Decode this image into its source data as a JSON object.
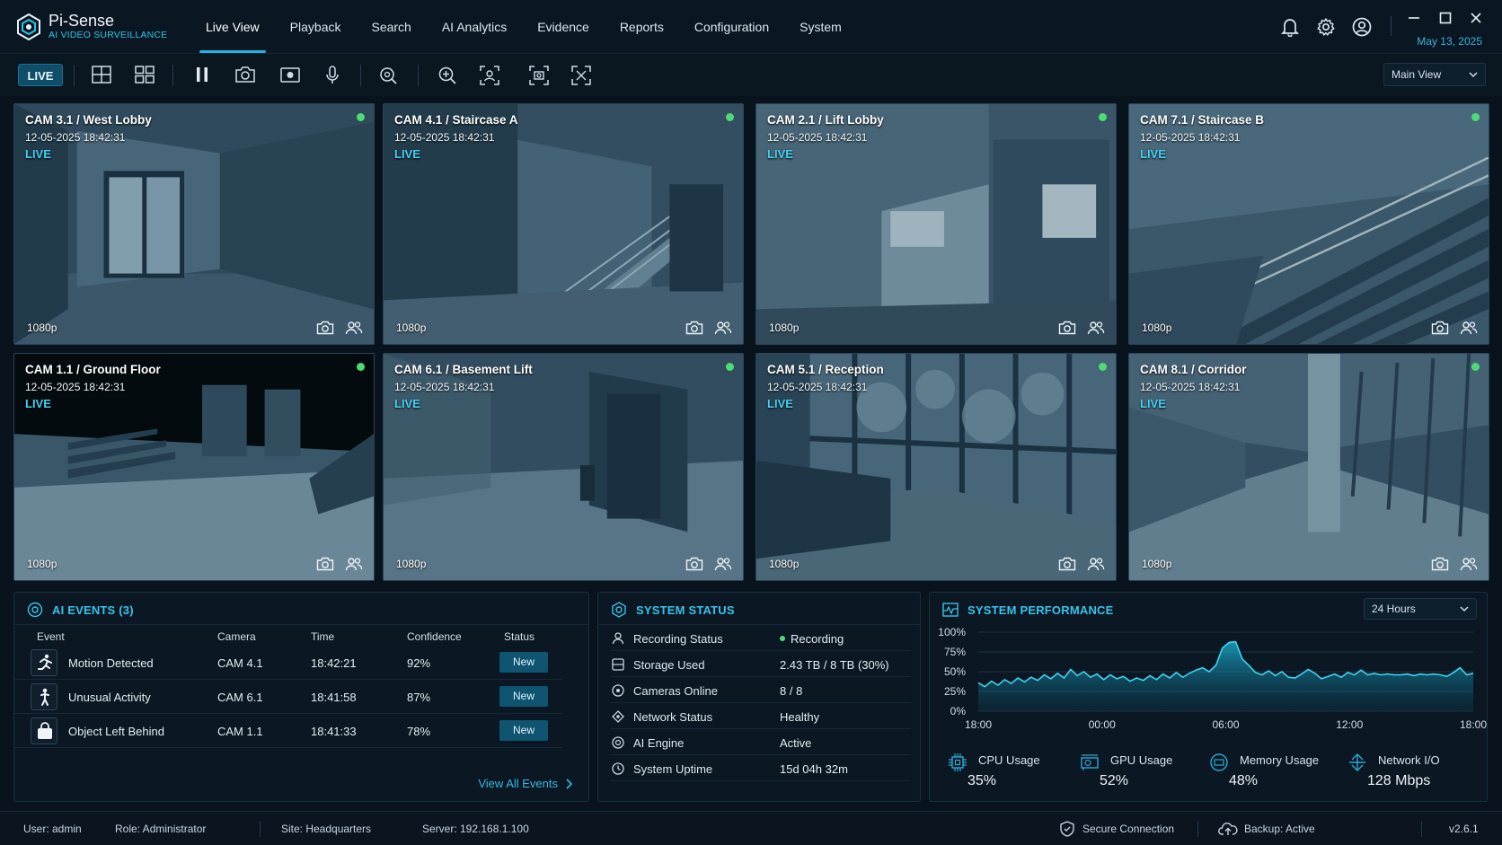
{
  "app": {
    "name": "Pi-Sense",
    "subtitle": "AI VIDEO SURVEILLANCE",
    "date": "May 13, 2025"
  },
  "nav": {
    "items": [
      "Live View",
      "Playback",
      "Search",
      "AI Analytics",
      "Evidence",
      "Reports",
      "Configuration",
      "System"
    ],
    "active_index": 0
  },
  "toolbar": {
    "live_label": "LIVE",
    "view_select": "Main View"
  },
  "cameras": [
    {
      "title": "CAM 3.1 / West Lobby",
      "timestamp": "12-05-2025 18:42:31",
      "status": "LIVE",
      "resolution": "1080p"
    },
    {
      "title": "CAM 4.1 / Staircase A",
      "timestamp": "12-05-2025 18:42:31",
      "status": "LIVE",
      "resolution": "1080p"
    },
    {
      "title": "CAM 2.1 / Lift Lobby",
      "timestamp": "12-05-2025 18:42:31",
      "status": "LIVE",
      "resolution": "1080p"
    },
    {
      "title": "CAM 7.1 / Staircase B",
      "timestamp": "12-05-2025 18:42:31",
      "status": "LIVE",
      "resolution": "1080p"
    },
    {
      "title": "CAM 1.1 / Ground Floor",
      "timestamp": "12-05-2025 18:42:31",
      "status": "LIVE",
      "resolution": "1080p"
    },
    {
      "title": "CAM 6.1 / Basement Lift",
      "timestamp": "12-05-2025 18:42:31",
      "status": "LIVE",
      "resolution": "1080p"
    },
    {
      "title": "CAM 5.1 / Reception",
      "timestamp": "12-05-2025 18:42:31",
      "status": "LIVE",
      "resolution": "1080p"
    },
    {
      "title": "CAM 8.1 / Corridor",
      "timestamp": "12-05-2025 18:42:31",
      "status": "LIVE",
      "resolution": "1080p"
    }
  ],
  "ai_events": {
    "title": "AI EVENTS (3)",
    "columns": [
      "Event",
      "Camera",
      "Time",
      "Confidence",
      "Status"
    ],
    "rows": [
      {
        "event": "Motion Detected",
        "camera": "CAM 4.1",
        "time": "18:42:21",
        "confidence": "92%",
        "status": "New",
        "icon": "running-person-icon"
      },
      {
        "event": "Unusual Activity",
        "camera": "CAM 6.1",
        "time": "18:41:58",
        "confidence": "87%",
        "status": "New",
        "icon": "standing-person-icon"
      },
      {
        "event": "Object Left Behind",
        "camera": "CAM 1.1",
        "time": "18:41:33",
        "confidence": "78%",
        "status": "New",
        "icon": "bag-icon"
      }
    ],
    "view_all": "View All Events"
  },
  "system_status": {
    "title": "SYSTEM STATUS",
    "rows": [
      {
        "label": "Recording Status",
        "value": "Recording",
        "icon": "person-rec-icon"
      },
      {
        "label": "Storage Used",
        "value": "2.43 TB / 8 TB (30%)",
        "icon": "storage-icon"
      },
      {
        "label": "Cameras Online",
        "value": "8 / 8",
        "icon": "camera-online-icon"
      },
      {
        "label": "Network Status",
        "value": "Healthy",
        "icon": "network-icon"
      },
      {
        "label": "AI Engine",
        "value": "Active",
        "icon": "ai-engine-icon"
      },
      {
        "label": "System Uptime",
        "value": "15d 04h 32m",
        "icon": "clock-icon"
      }
    ]
  },
  "performance": {
    "title": "SYSTEM PERFORMANCE",
    "range": "24 Hours",
    "metrics": [
      {
        "label": "CPU Usage",
        "value": "35%",
        "icon": "cpu-icon"
      },
      {
        "label": "GPU Usage",
        "value": "52%",
        "icon": "gpu-icon"
      },
      {
        "label": "Memory Usage",
        "value": "48%",
        "icon": "memory-icon"
      },
      {
        "label": "Network I/O",
        "value": "128 Mbps",
        "icon": "network-io-icon"
      }
    ]
  },
  "chart_data": {
    "type": "area",
    "x_ticks": [
      "18:00",
      "00:00",
      "06:00",
      "12:00",
      "18:00"
    ],
    "y_ticks": [
      "100%",
      "75%",
      "50%",
      "25%",
      "0%"
    ],
    "ylim": [
      0,
      100
    ],
    "series": [
      {
        "values": [
          36,
          31,
          38,
          33,
          40,
          35,
          42,
          37,
          43,
          39,
          46,
          41,
          48,
          42,
          53,
          45,
          50,
          43,
          47,
          40,
          46,
          41,
          44,
          38,
          42,
          39,
          45,
          40,
          47,
          42,
          49,
          43,
          48,
          52,
          55,
          50,
          58,
          80,
          87,
          88,
          66,
          58,
          49,
          46,
          51,
          45,
          50,
          43,
          42,
          47,
          53,
          48,
          41,
          44,
          47,
          43,
          49,
          46,
          52,
          46,
          48,
          46,
          47,
          46,
          46,
          47,
          45,
          47,
          46,
          47,
          46,
          44,
          49,
          55,
          46,
          48
        ]
      }
    ],
    "grid": true
  },
  "statusbar": {
    "user": "User:  admin",
    "role": "Role:  Administrator",
    "site": "Site:  Headquarters",
    "server": "Server:  192.168.1.100",
    "secure": "Secure Connection",
    "backup": "Backup: Active",
    "version": "v2.6.1"
  }
}
